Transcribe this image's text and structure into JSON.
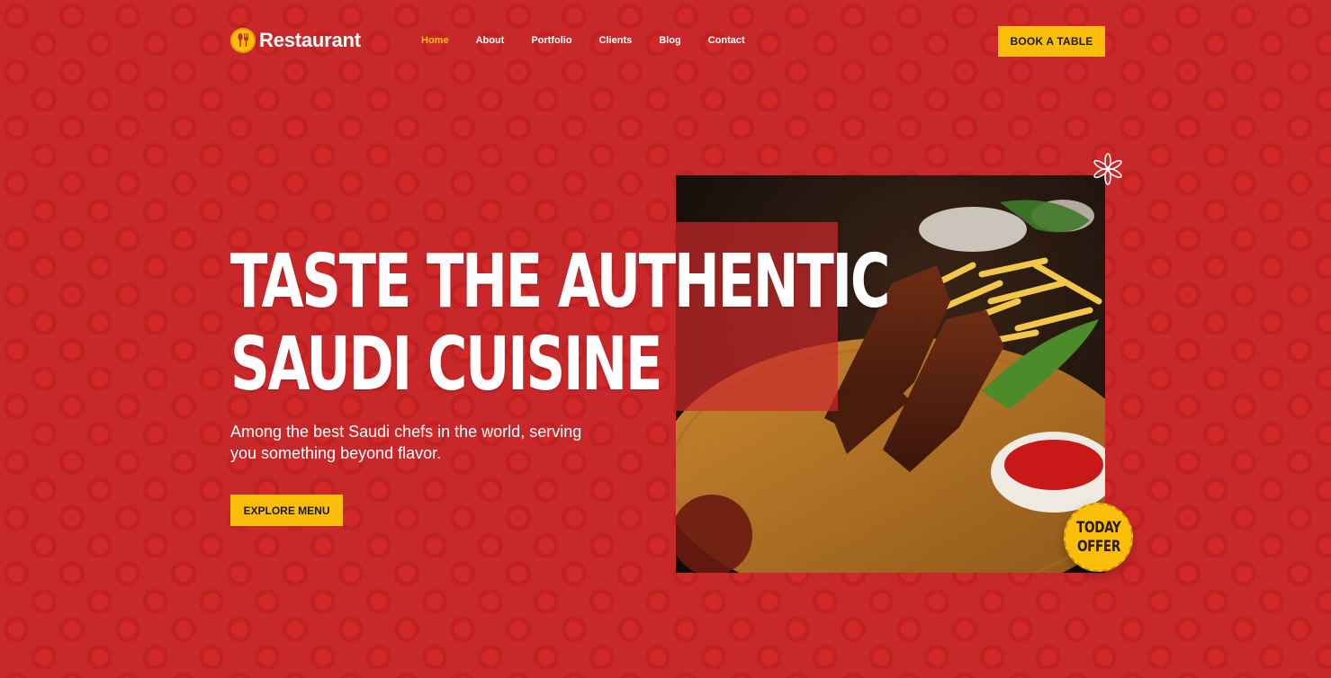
{
  "brand": {
    "name": "Restaurant",
    "icon": "fork-spoon-icon"
  },
  "nav": [
    {
      "label": "Home",
      "active": true
    },
    {
      "label": "About",
      "active": false
    },
    {
      "label": "Portfolio",
      "active": false
    },
    {
      "label": "Clients",
      "active": false
    },
    {
      "label": "Blog",
      "active": false
    },
    {
      "label": "Contact",
      "active": false
    }
  ],
  "header": {
    "cta_label": "BOOK A TABLE"
  },
  "hero": {
    "title_line1": "TASTE THE AUTHENTIC",
    "title_line2": "SAUDI CUISINE",
    "description": "Among the best Saudi chefs in the world, serving you something beyond flavor.",
    "cta_label": "EXPLORE MENU",
    "image_alt": "grilled ribs with fries",
    "badge_line1": "TODAY",
    "badge_line2": "OFFER"
  },
  "colors": {
    "background": "#c9282a",
    "accent": "#fbbf0b",
    "text": "#ffffff"
  }
}
